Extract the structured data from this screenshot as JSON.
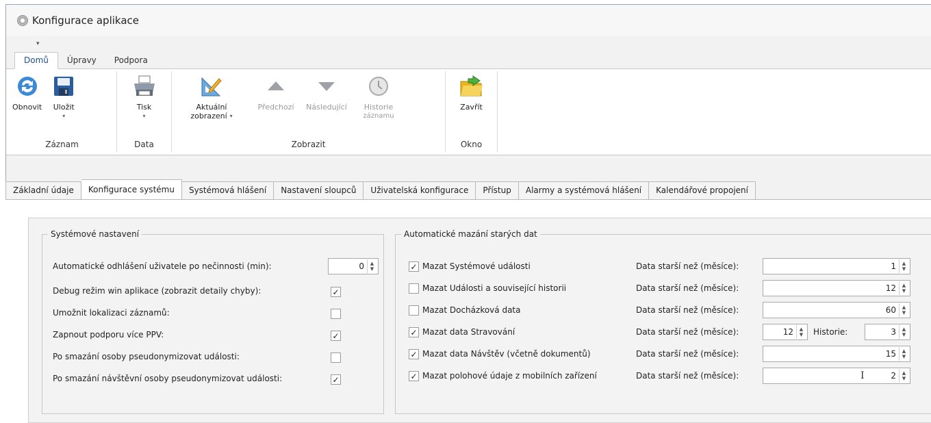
{
  "window": {
    "title": "Konfigurace aplikace",
    "qat_arrow": "▾"
  },
  "ribbon_tabs": [
    "Domů",
    "Úpravy",
    "Podpora"
  ],
  "groups": {
    "zaznam": {
      "label": "Záznam",
      "obnovit": "Obnovit",
      "ulozit": "Uložit"
    },
    "data": {
      "label": "Data",
      "tisk": "Tisk"
    },
    "zobrazit": {
      "label": "Zobrazit",
      "aktualni_1": "Aktuální",
      "aktualni_2": "zobrazení",
      "predchozi": "Předchozí",
      "nasledujici": "Následující",
      "historie_1": "Historie",
      "historie_2": "záznamu"
    },
    "okno": {
      "label": "Okno",
      "zavrit": "Zavřít"
    }
  },
  "doc_tabs": [
    "Základní údaje",
    "Konfigurace systému",
    "Systémová hlášení",
    "Nastavení sloupců",
    "Uživatelská konfigurace",
    "Přístup",
    "Alarmy a systémová hlášení",
    "Kalendářové propojení"
  ],
  "system": {
    "legend": "Systémové nastavení",
    "logout_label": "Automatické odhlášení uživatele po nečinnosti (min):",
    "logout_value": "0",
    "rows": [
      {
        "label": "Debug režim win aplikace (zobrazit detaily chyby):",
        "checked": true
      },
      {
        "label": "Umožnit lokalizaci záznamů:",
        "checked": false
      },
      {
        "label": "Zapnout podporu více PPV:",
        "checked": true
      },
      {
        "label": "Po smazání osoby pseudonymizovat události:",
        "checked": false
      },
      {
        "label": "Po smazání návštěvní osoby pseudonymizovat události:",
        "checked": true
      }
    ]
  },
  "autodelete": {
    "legend": "Automatické mazání starých dat",
    "older_label": "Data starší než (měsíce):",
    "history_label": "Historie:",
    "history_value": "3",
    "rows": [
      {
        "label": "Mazat Systémové události",
        "checked": true,
        "value": "1"
      },
      {
        "label": "Mazat Události a související historii",
        "checked": false,
        "value": "12"
      },
      {
        "label": "Mazat Docházková data",
        "checked": false,
        "value": "60"
      },
      {
        "label": "Mazat data Stravování",
        "checked": true,
        "value": "12"
      },
      {
        "label": "Mazat data Návštěv (včetně dokumentů)",
        "checked": true,
        "value": "15"
      },
      {
        "label": "Mazat polohové údaje z mobilních zařízení",
        "checked": true,
        "value": "2"
      }
    ]
  },
  "icons": {
    "check": "✓",
    "up": "▲",
    "down": "▼",
    "caret": "▾",
    "cursor": "I"
  },
  "colors": {
    "accent": "#1f4e8c",
    "border": "#c7c7c7"
  }
}
